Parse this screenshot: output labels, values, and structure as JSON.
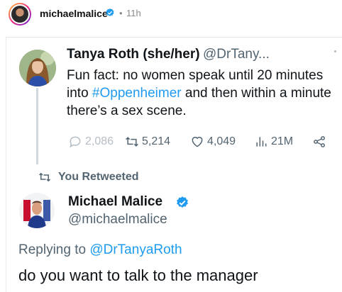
{
  "post": {
    "username": "michaelmalice",
    "separator": "•",
    "time": "11h"
  },
  "quoted_tweet": {
    "name": "Tanya Roth (she/her)",
    "handle": "@DrTany...",
    "text_before": "Fun fact: no women speak until 20 minutes into ",
    "hashtag": "#Oppenheimer",
    "text_after": " and then within a minute there’s a sex scene.",
    "metrics": {
      "replies": "2,086",
      "retweets": "5,214",
      "likes": "4,049",
      "views": "21M"
    }
  },
  "retweet_indicator": {
    "label": "You Retweeted"
  },
  "reply_tweet": {
    "name": "Michael Malice",
    "handle": "@michaelmalice",
    "replying_prefix": "Replying to ",
    "replying_to": "@DrTanyaRoth",
    "text": "do you want to talk to the manager"
  },
  "colors": {
    "link_blue": "#1d9bf0",
    "verified_blue": "#1d9bf0",
    "secondary_text": "#536471",
    "thread_line": "#cfd9de"
  },
  "icons": {
    "reply": "speech-bubble-icon",
    "retweet": "retweet-icon",
    "like": "heart-icon",
    "views": "bar-chart-icon",
    "share": "share-icon",
    "verified": "verified-badge-icon"
  }
}
